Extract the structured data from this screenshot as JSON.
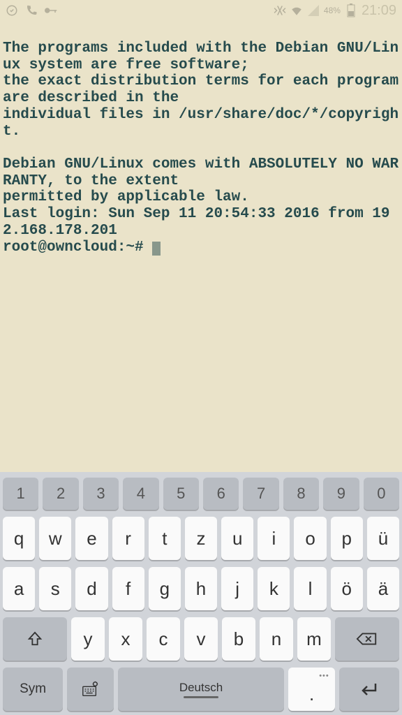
{
  "status_bar": {
    "battery_percent": "48%",
    "clock": "21:09"
  },
  "terminal": {
    "line1": "The programs included with the Debian GNU/Linux system are free software;",
    "line2": "the exact distribution terms for each program are described in the",
    "line3": "individual files in /usr/share/doc/*/copyright.",
    "line4": "Debian GNU/Linux comes with ABSOLUTELY NO WARRANTY, to the extent",
    "line5": "permitted by applicable law.",
    "line6": "Last login: Sun Sep 11 20:54:33 2016 from 192.168.178.201",
    "prompt": "root@owncloud:~# "
  },
  "keyboard": {
    "row_num": [
      "1",
      "2",
      "3",
      "4",
      "5",
      "6",
      "7",
      "8",
      "9",
      "0"
    ],
    "row_q": [
      "q",
      "w",
      "e",
      "r",
      "t",
      "z",
      "u",
      "i",
      "o",
      "p",
      "ü"
    ],
    "row_a": [
      "a",
      "s",
      "d",
      "f",
      "g",
      "h",
      "j",
      "k",
      "l",
      "ö",
      "ä"
    ],
    "row_y": [
      "y",
      "x",
      "c",
      "v",
      "b",
      "n",
      "m"
    ],
    "sym_label": "Sym",
    "space_label": "Deutsch",
    "period_label": ".",
    "period_dots": "•••"
  }
}
